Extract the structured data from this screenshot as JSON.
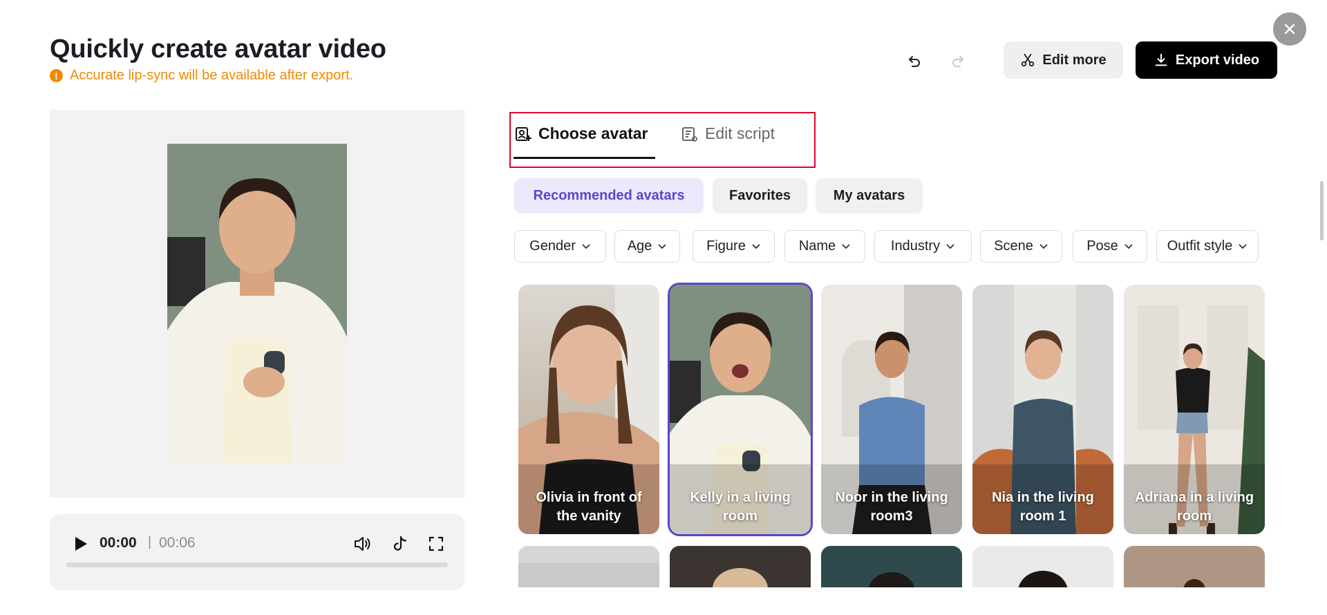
{
  "header": {
    "title": "Quickly create avatar video",
    "warning": "Accurate lip-sync will be available after export.",
    "edit_more": "Edit more",
    "export": "Export video"
  },
  "player": {
    "current_time": "00:00",
    "separator": "|",
    "total_time": "00:06",
    "progress": 0
  },
  "tabs": [
    {
      "label": "Choose avatar",
      "active": true
    },
    {
      "label": "Edit script",
      "active": false
    }
  ],
  "segments": [
    {
      "label": "Recommended avatars",
      "active": true
    },
    {
      "label": "Favorites",
      "active": false
    },
    {
      "label": "My avatars",
      "active": false
    }
  ],
  "filters": [
    "Gender",
    "Age",
    "Figure",
    "Name",
    "Industry",
    "Scene",
    "Pose",
    "Outfit style"
  ],
  "avatars": [
    {
      "name": "Olivia in front of the vanity",
      "selected": false
    },
    {
      "name": "Kelly in a living room",
      "selected": true
    },
    {
      "name": "Noor in the living room3",
      "selected": false
    },
    {
      "name": "Nia in the living room 1",
      "selected": false
    },
    {
      "name": "Adriana in a living room",
      "selected": false
    }
  ],
  "colors": {
    "accent": "#5a46c9",
    "warning": "#f08a00",
    "highlight_box": "#e0002a"
  }
}
